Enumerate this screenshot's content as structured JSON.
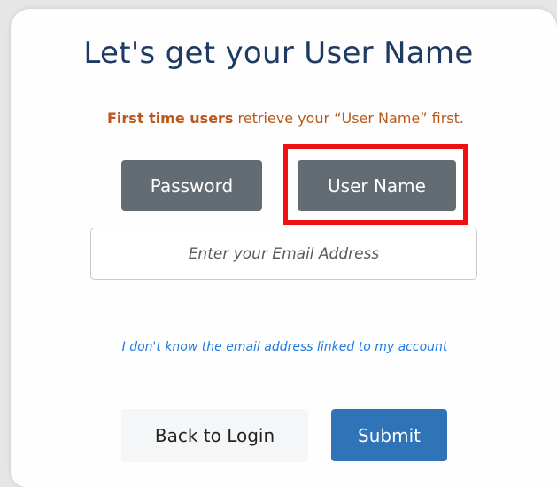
{
  "title": "Let's get your User Name",
  "subtitle": {
    "strong": "First time users",
    "rest": " retrieve your “User Name” first."
  },
  "toggle": {
    "password_label": "Password",
    "username_label": "User Name"
  },
  "email": {
    "placeholder": "Enter your Email Address",
    "value": ""
  },
  "help_link": "I don't know the email address linked to my account",
  "actions": {
    "back_label": "Back to Login",
    "submit_label": "Submit"
  },
  "colors": {
    "title": "#1f3a63",
    "subtitle": "#b9581a",
    "toggle_button": "#636b73",
    "highlight": "#ee1111",
    "link": "#1f7be0",
    "submit": "#2f74b6"
  }
}
